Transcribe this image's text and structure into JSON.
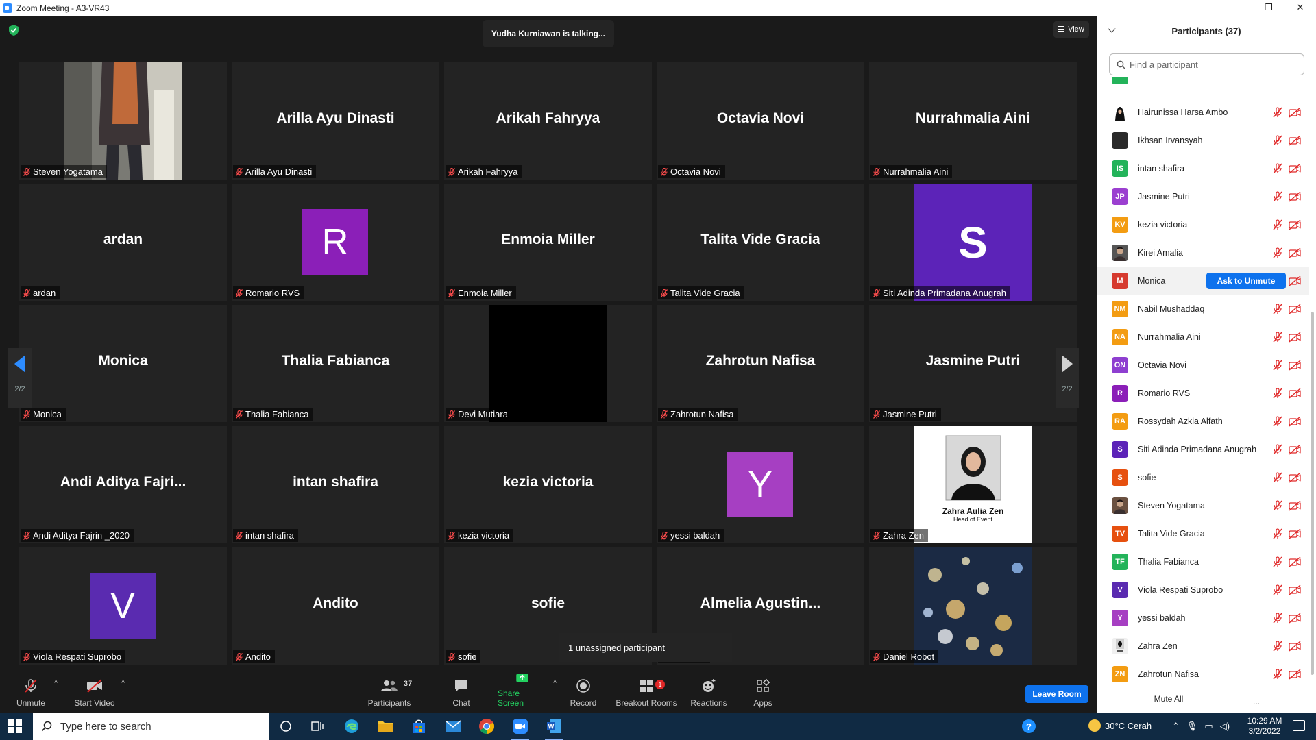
{
  "window": {
    "title": "Zoom Meeting - A3-VR43",
    "controls": [
      "—",
      "❐",
      "✕"
    ]
  },
  "meeting": {
    "talking_banner": "Yudha Kurniawan is talking...",
    "view_label": "View",
    "page_indicator": "2/2",
    "unassigned_notice": "1 unassigned participant",
    "tiles": [
      {
        "big": "",
        "label": "Steven Yogatama",
        "type": "photo-person"
      },
      {
        "big": "Arilla Ayu Dinasti",
        "label": "Arilla Ayu Dinasti",
        "type": "name"
      },
      {
        "big": "Arikah Fahryya",
        "label": "Arikah Fahryya",
        "type": "name"
      },
      {
        "big": "Octavia Novi",
        "label": "Octavia Novi",
        "type": "name"
      },
      {
        "big": "Nurrahmalia Aini",
        "label": "Nurrahmalia Aini",
        "type": "name"
      },
      {
        "big": "ardan",
        "label": "ardan",
        "type": "name"
      },
      {
        "big": "R",
        "label": "Romario RVS",
        "type": "avatar",
        "color": "#8b1fb8"
      },
      {
        "big": "Enmoia Miller",
        "label": "Enmoia Miller",
        "type": "name"
      },
      {
        "big": "Talita Vide Gracia",
        "label": "Talita Vide Gracia",
        "type": "name"
      },
      {
        "big": "S",
        "label": "Siti Adinda Primadana Anugrah",
        "type": "avatar-large",
        "color": "#5c23b8"
      },
      {
        "big": "Monica",
        "label": "Monica",
        "type": "name"
      },
      {
        "big": "Thalia Fabianca",
        "label": "Thalia Fabianca",
        "type": "name"
      },
      {
        "big": "",
        "label": "Devi Mutiara",
        "type": "black"
      },
      {
        "big": "Zahrotun Nafisa",
        "label": "Zahrotun Nafisa",
        "type": "name"
      },
      {
        "big": "Jasmine Putri",
        "label": "Jasmine Putri",
        "type": "name"
      },
      {
        "big": "Andi  Aditya  Fajri...",
        "label": "Andi Aditya Fajrin _2020",
        "type": "name"
      },
      {
        "big": "intan shafira",
        "label": "intan shafira",
        "type": "name"
      },
      {
        "big": "kezia victoria",
        "label": "kezia victoria",
        "type": "name"
      },
      {
        "big": "Y",
        "label": "yessi baldah",
        "type": "avatar",
        "color": "#a63fc2"
      },
      {
        "big": "",
        "label": "Zahra Zen",
        "type": "card",
        "card_name": "Zahra Aulia Zen",
        "card_role": "Head of Event"
      },
      {
        "big": "V",
        "label": "Viola Respati Suprobo",
        "type": "avatar",
        "color": "#5a2bb0"
      },
      {
        "big": "Andito",
        "label": "Andito",
        "type": "name"
      },
      {
        "big": "sofie",
        "label": "sofie",
        "type": "name"
      },
      {
        "big": "Almelia  Agustin...",
        "label": "a Kbarek",
        "type": "name"
      },
      {
        "big": "",
        "label": "Daniel Robot",
        "type": "bokeh"
      }
    ]
  },
  "toolbar": {
    "unmute": "Unmute",
    "start_video": "Start Video",
    "participants": "Participants",
    "participants_count": "37",
    "chat": "Chat",
    "share_screen": "Share Screen",
    "record": "Record",
    "breakout_rooms": "Breakout Rooms",
    "breakout_badge": "1",
    "reactions": "Reactions",
    "apps": "Apps",
    "leave": "Leave Room"
  },
  "panel": {
    "title": "Participants (37)",
    "search_placeholder": "Find a participant",
    "ask_to_unmute": "Ask to Unmute",
    "mute_all": "Mute All",
    "more": "...",
    "participants": [
      {
        "name": "Hairunissa Harsa Ambo",
        "initials": "",
        "color": "#ffffff",
        "img": "hijab"
      },
      {
        "name": "Ikhsan Irvansyah",
        "initials": "",
        "color": "#2a2a2a",
        "img": "dark"
      },
      {
        "name": "intan shafira",
        "initials": "IS",
        "color": "#23b35a"
      },
      {
        "name": "Jasmine Putri",
        "initials": "JP",
        "color": "#9b3fd0"
      },
      {
        "name": "kezia victoria",
        "initials": "KV",
        "color": "#f39c12"
      },
      {
        "name": "Kirei Amalia",
        "initials": "",
        "color": "#555555",
        "img": "photo"
      },
      {
        "name": "Monica",
        "initials": "M",
        "color": "#d63a2f",
        "ask": true
      },
      {
        "name": "Nabil Mushaddaq",
        "initials": "NM",
        "color": "#f39c12"
      },
      {
        "name": "Nurrahmalia Aini",
        "initials": "NA",
        "color": "#f39c12"
      },
      {
        "name": "Octavia Novi",
        "initials": "ON",
        "color": "#8e3fd0"
      },
      {
        "name": "Romario RVS",
        "initials": "R",
        "color": "#8b1fb8"
      },
      {
        "name": "Rossydah Azkia Alfath",
        "initials": "RA",
        "color": "#f39c12"
      },
      {
        "name": "Siti Adinda Primadana Anugrah",
        "initials": "S",
        "color": "#5c23b8"
      },
      {
        "name": "sofie",
        "initials": "S",
        "color": "#e6500f"
      },
      {
        "name": "Steven Yogatama",
        "initials": "",
        "color": "#6a5040",
        "img": "photo"
      },
      {
        "name": "Talita Vide Gracia",
        "initials": "TV",
        "color": "#e6500f"
      },
      {
        "name": "Thalia Fabianca",
        "initials": "TF",
        "color": "#23b35a"
      },
      {
        "name": "Viola Respati Suprobo",
        "initials": "V",
        "color": "#5a2bb0"
      },
      {
        "name": "yessi baldah",
        "initials": "Y",
        "color": "#a63fc2"
      },
      {
        "name": "Zahra Zen",
        "initials": "",
        "color": "#f0f0f0",
        "img": "card"
      },
      {
        "name": "Zahrotun Nafisa",
        "initials": "ZN",
        "color": "#f39c12"
      }
    ]
  },
  "taskbar": {
    "search_placeholder": "Type here to search",
    "weather": "30°C  Cerah",
    "time": "10:29 AM",
    "date": "3/2/2022",
    "help": "?"
  }
}
